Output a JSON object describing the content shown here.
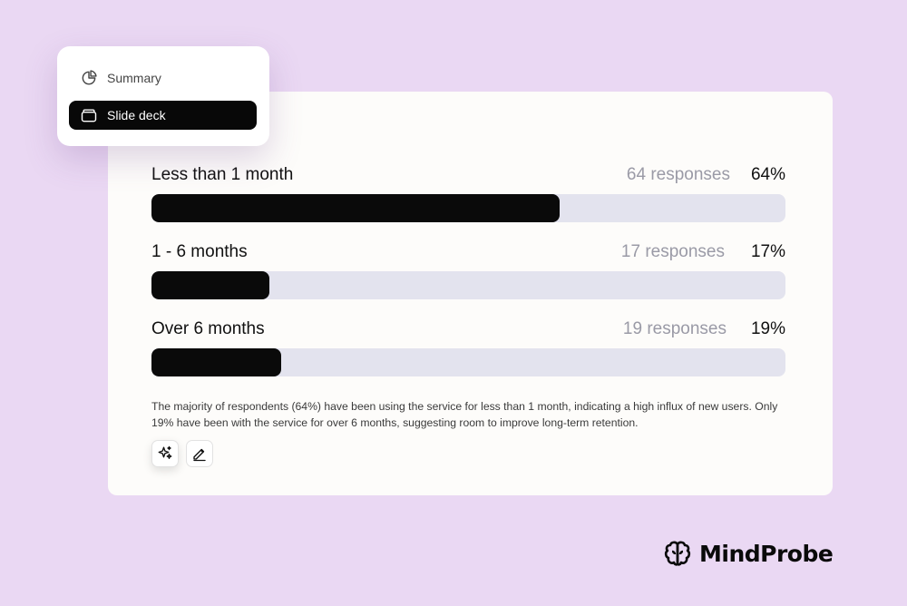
{
  "menu": {
    "items": [
      {
        "label": "Summary",
        "icon": "pie-chart-icon",
        "active": false
      },
      {
        "label": "Slide deck",
        "icon": "slide-deck-icon",
        "active": true
      }
    ]
  },
  "chart_data": {
    "type": "bar",
    "orientation": "horizontal",
    "categories": [
      "Less than 1 month",
      "1 - 6 months",
      "Over 6 months"
    ],
    "values": [
      64,
      17,
      19
    ],
    "counts": [
      "64 responses",
      "17 responses",
      "19 responses"
    ],
    "percent_labels": [
      "64%",
      "17%",
      "19%"
    ],
    "xlim": [
      0,
      100
    ],
    "colors": {
      "fill": "#0a0a0a",
      "track": "#e3e3ee"
    }
  },
  "insight": "The majority of respondents (64%) have been using the service for less than 1 month, indicating a high influx of new users. Only 19% have been with the service for over 6 months, suggesting room to improve long-term retention.",
  "actions": [
    {
      "icon": "sparkle-icon"
    },
    {
      "icon": "edit-icon"
    }
  ],
  "brand": {
    "name": "MindProbe",
    "icon": "brain-icon"
  },
  "colors": {
    "background": "#ead8f3",
    "card": "#fdfcfa"
  }
}
